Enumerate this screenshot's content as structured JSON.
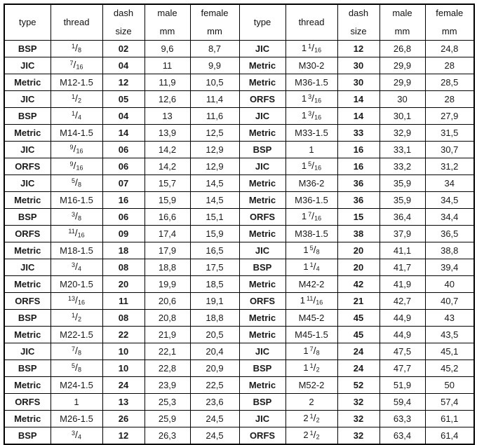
{
  "table": {
    "columns": [
      "type",
      "thread",
      "dash size",
      "male mm",
      "female mm"
    ],
    "headers": {
      "type": "type",
      "thread": "thread",
      "dash_line1": "dash",
      "dash_line2": "size",
      "male_line1": "male",
      "male_line2": "mm",
      "female_line1": "female",
      "female_line2": "mm"
    },
    "left_rows": [
      {
        "type": "BSP",
        "whole": "",
        "num": "1",
        "den": "8",
        "plain": "",
        "dash": "02",
        "male": "9,6",
        "female": "8,7"
      },
      {
        "type": "JIC",
        "whole": "",
        "num": "7",
        "den": "16",
        "plain": "",
        "dash": "04",
        "male": "11",
        "female": "9,9"
      },
      {
        "type": "Metric",
        "whole": "",
        "num": "",
        "den": "",
        "plain": "M12-1.5",
        "dash": "12",
        "male": "11,9",
        "female": "10,5"
      },
      {
        "type": "JIC",
        "whole": "",
        "num": "1",
        "den": "2",
        "plain": "",
        "dash": "05",
        "male": "12,6",
        "female": "11,4"
      },
      {
        "type": "BSP",
        "whole": "",
        "num": "1",
        "den": "4",
        "plain": "",
        "dash": "04",
        "male": "13",
        "female": "11,6"
      },
      {
        "type": "Metric",
        "whole": "",
        "num": "",
        "den": "",
        "plain": "M14-1.5",
        "dash": "14",
        "male": "13,9",
        "female": "12,5"
      },
      {
        "type": "JIC",
        "whole": "",
        "num": "9",
        "den": "16",
        "plain": "",
        "dash": "06",
        "male": "14,2",
        "female": "12,9"
      },
      {
        "type": "ORFS",
        "whole": "",
        "num": "9",
        "den": "16",
        "plain": "",
        "dash": "06",
        "male": "14,2",
        "female": "12,9"
      },
      {
        "type": "JIC",
        "whole": "",
        "num": "5",
        "den": "8",
        "plain": "",
        "dash": "07",
        "male": "15,7",
        "female": "14,5"
      },
      {
        "type": "Metric",
        "whole": "",
        "num": "",
        "den": "",
        "plain": "M16-1.5",
        "dash": "16",
        "male": "15,9",
        "female": "14,5"
      },
      {
        "type": "BSP",
        "whole": "",
        "num": "3",
        "den": "8",
        "plain": "",
        "dash": "06",
        "male": "16,6",
        "female": "15,1"
      },
      {
        "type": "ORFS",
        "whole": "",
        "num": "11",
        "den": "16",
        "plain": "",
        "dash": "09",
        "male": "17,4",
        "female": "15,9"
      },
      {
        "type": "Metric",
        "whole": "",
        "num": "",
        "den": "",
        "plain": "M18-1.5",
        "dash": "18",
        "male": "17,9",
        "female": "16,5"
      },
      {
        "type": "JIC",
        "whole": "",
        "num": "3",
        "den": "4",
        "plain": "",
        "dash": "08",
        "male": "18,8",
        "female": "17,5"
      },
      {
        "type": "Metric",
        "whole": "",
        "num": "",
        "den": "",
        "plain": "M20-1.5",
        "dash": "20",
        "male": "19,9",
        "female": "18,5"
      },
      {
        "type": "ORFS",
        "whole": "",
        "num": "13",
        "den": "16",
        "plain": "",
        "dash": "11",
        "male": "20,6",
        "female": "19,1"
      },
      {
        "type": "BSP",
        "whole": "",
        "num": "1",
        "den": "2",
        "plain": "",
        "dash": "08",
        "male": "20,8",
        "female": "18,8"
      },
      {
        "type": "Metric",
        "whole": "",
        "num": "",
        "den": "",
        "plain": "M22-1.5",
        "dash": "22",
        "male": "21,9",
        "female": "20,5"
      },
      {
        "type": "JIC",
        "whole": "",
        "num": "7",
        "den": "8",
        "plain": "",
        "dash": "10",
        "male": "22,1",
        "female": "20,4"
      },
      {
        "type": "BSP",
        "whole": "",
        "num": "5",
        "den": "8",
        "plain": "",
        "dash": "10",
        "male": "22,8",
        "female": "20,9"
      },
      {
        "type": "Metric",
        "whole": "",
        "num": "",
        "den": "",
        "plain": "M24-1.5",
        "dash": "24",
        "male": "23,9",
        "female": "22,5"
      },
      {
        "type": "ORFS",
        "whole": "",
        "num": "",
        "den": "",
        "plain": "1",
        "dash": "13",
        "male": "25,3",
        "female": "23,6"
      },
      {
        "type": "Metric",
        "whole": "",
        "num": "",
        "den": "",
        "plain": "M26-1.5",
        "dash": "26",
        "male": "25,9",
        "female": "24,5"
      },
      {
        "type": "BSP",
        "whole": "",
        "num": "3",
        "den": "4",
        "plain": "",
        "dash": "12",
        "male": "26,3",
        "female": "24,5"
      }
    ],
    "right_rows": [
      {
        "type": "JIC",
        "whole": "1",
        "num": "1",
        "den": "16",
        "plain": "",
        "dash": "12",
        "male": "26,8",
        "female": "24,8"
      },
      {
        "type": "Metric",
        "whole": "",
        "num": "",
        "den": "",
        "plain": "M30-2",
        "dash": "30",
        "male": "29,9",
        "female": "28"
      },
      {
        "type": "Metric",
        "whole": "",
        "num": "",
        "den": "",
        "plain": "M36-1.5",
        "dash": "30",
        "male": "29,9",
        "female": "28,5"
      },
      {
        "type": "ORFS",
        "whole": "1",
        "num": "3",
        "den": "16",
        "plain": "",
        "dash": "14",
        "male": "30",
        "female": "28"
      },
      {
        "type": "JIC",
        "whole": "1",
        "num": "3",
        "den": "16",
        "plain": "",
        "dash": "14",
        "male": "30,1",
        "female": "27,9"
      },
      {
        "type": "Metric",
        "whole": "",
        "num": "",
        "den": "",
        "plain": "M33-1.5",
        "dash": "33",
        "male": "32,9",
        "female": "31,5"
      },
      {
        "type": "BSP",
        "whole": "",
        "num": "",
        "den": "",
        "plain": "1",
        "dash": "16",
        "male": "33,1",
        "female": "30,7"
      },
      {
        "type": "JIC",
        "whole": "1",
        "num": "5",
        "den": "16",
        "plain": "",
        "dash": "16",
        "male": "33,2",
        "female": "31,2"
      },
      {
        "type": "Metric",
        "whole": "",
        "num": "",
        "den": "",
        "plain": "M36-2",
        "dash": "36",
        "male": "35,9",
        "female": "34"
      },
      {
        "type": "Metric",
        "whole": "",
        "num": "",
        "den": "",
        "plain": "M36-1.5",
        "dash": "36",
        "male": "35,9",
        "female": "34,5"
      },
      {
        "type": "ORFS",
        "whole": "1",
        "num": "7",
        "den": "16",
        "plain": "",
        "dash": "15",
        "male": "36,4",
        "female": "34,4"
      },
      {
        "type": "Metric",
        "whole": "",
        "num": "",
        "den": "",
        "plain": "M38-1.5",
        "dash": "38",
        "male": "37,9",
        "female": "36,5"
      },
      {
        "type": "JIC",
        "whole": "1",
        "num": "5",
        "den": "8",
        "plain": "",
        "dash": "20",
        "male": "41,1",
        "female": "38,8"
      },
      {
        "type": "BSP",
        "whole": "1",
        "num": "1",
        "den": "4",
        "plain": "",
        "dash": "20",
        "male": "41,7",
        "female": "39,4"
      },
      {
        "type": "Metric",
        "whole": "",
        "num": "",
        "den": "",
        "plain": "M42-2",
        "dash": "42",
        "male": "41,9",
        "female": "40"
      },
      {
        "type": "ORFS",
        "whole": "1",
        "num": "11",
        "den": "16",
        "plain": "",
        "dash": "21",
        "male": "42,7",
        "female": "40,7"
      },
      {
        "type": "Metric",
        "whole": "",
        "num": "",
        "den": "",
        "plain": "M45-2",
        "dash": "45",
        "male": "44,9",
        "female": "43"
      },
      {
        "type": "Metric",
        "whole": "",
        "num": "",
        "den": "",
        "plain": "M45-1.5",
        "dash": "45",
        "male": "44,9",
        "female": "43,5"
      },
      {
        "type": "JIC",
        "whole": "1",
        "num": "7",
        "den": "8",
        "plain": "",
        "dash": "24",
        "male": "47,5",
        "female": "45,1"
      },
      {
        "type": "BSP",
        "whole": "1",
        "num": "1",
        "den": "2",
        "plain": "",
        "dash": "24",
        "male": "47,7",
        "female": "45,2"
      },
      {
        "type": "Metric",
        "whole": "",
        "num": "",
        "den": "",
        "plain": "M52-2",
        "dash": "52",
        "male": "51,9",
        "female": "50"
      },
      {
        "type": "BSP",
        "whole": "",
        "num": "",
        "den": "",
        "plain": "2",
        "dash": "32",
        "male": "59,4",
        "female": "57,4"
      },
      {
        "type": "JIC",
        "whole": "2",
        "num": "1",
        "den": "2",
        "plain": "",
        "dash": "32",
        "male": "63,3",
        "female": "61,1"
      },
      {
        "type": "ORFS",
        "whole": "2",
        "num": "1",
        "den": "2",
        "plain": "",
        "dash": "32",
        "male": "63,4",
        "female": "61,4"
      }
    ]
  },
  "colors": {
    "header_type_bg": "#c9c9c9",
    "cell_type_bg": "#c9c9c9",
    "border": "#000000",
    "page_bg": "#ffffff",
    "text": "#1a1a1a"
  }
}
